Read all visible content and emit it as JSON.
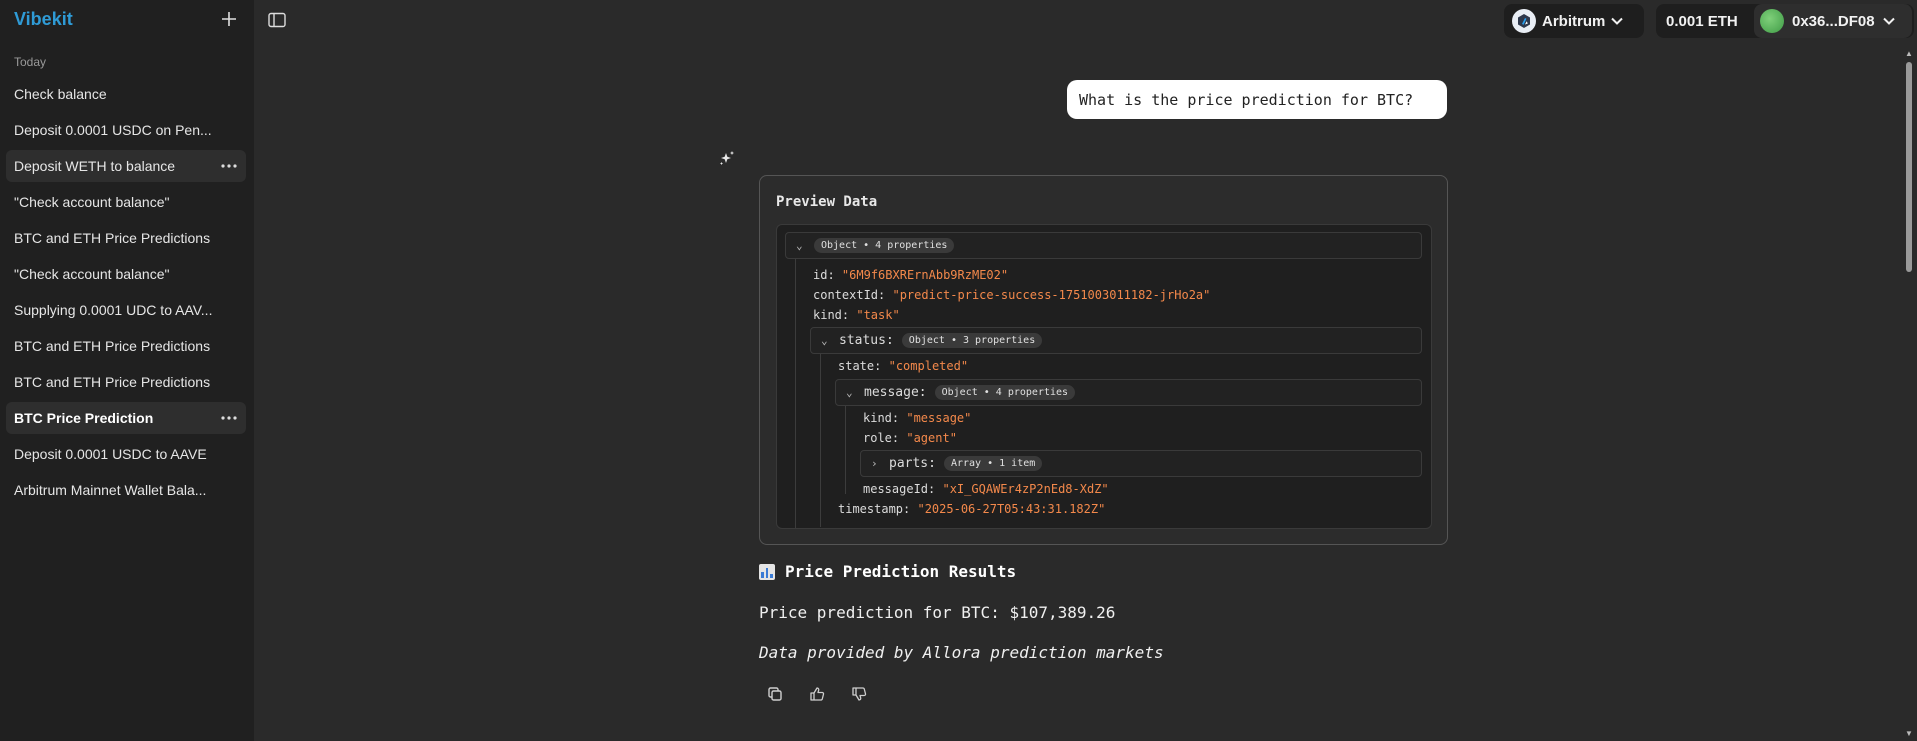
{
  "sidebar": {
    "brand": "Vibekit",
    "section_label": "Today",
    "items": [
      {
        "label": "Check balance"
      },
      {
        "label": "Deposit 0.0001 USDC on Pen..."
      },
      {
        "label": "Deposit WETH to balance"
      },
      {
        "label": "\"Check account balance\""
      },
      {
        "label": "BTC and ETH Price Predictions"
      },
      {
        "label": "\"Check account balance\""
      },
      {
        "label": "Supplying 0.0001 UDC to AAV..."
      },
      {
        "label": "BTC and ETH Price Predictions"
      },
      {
        "label": "BTC and ETH Price Predictions"
      },
      {
        "label": "BTC Price Prediction"
      },
      {
        "label": "Deposit 0.0001 USDC to AAVE"
      },
      {
        "label": "Arbitrum Mainnet Wallet Bala..."
      }
    ]
  },
  "topbar": {
    "network": "Arbitrum",
    "balance": "0.001 ETH",
    "account": "0x36...DF08"
  },
  "chat": {
    "user_message": "What is the price prediction for BTC?",
    "preview": {
      "title": "Preview Data",
      "root_badge": "Object • 4 properties",
      "id_key": "id:",
      "id_val": "\"6M9f6BXRErnAbb9RzME02\"",
      "context_key": "contextId:",
      "context_val": "\"predict-price-success-1751003011182-jrHo2a\"",
      "kind_key": "kind:",
      "kind_val": "\"task\"",
      "status_key": "status:",
      "status_badge": "Object • 3 properties",
      "state_key": "state:",
      "state_val": "\"completed\"",
      "message_key": "message:",
      "message_badge": "Object • 4 properties",
      "msg_kind_key": "kind:",
      "msg_kind_val": "\"message\"",
      "role_key": "role:",
      "role_val": "\"agent\"",
      "parts_key": "parts:",
      "parts_badge": "Array • 1 item",
      "messageid_key": "messageId:",
      "messageid_val": "\"xI_GQAWEr4zP2nEd8-XdZ\"",
      "timestamp_key": "timestamp:",
      "timestamp_val": "\"2025-06-27T05:43:31.182Z\""
    },
    "results_heading": "Price Prediction Results",
    "prediction": "Price prediction for BTC: $107,389.26",
    "source": "Data provided by Allora prediction markets"
  }
}
